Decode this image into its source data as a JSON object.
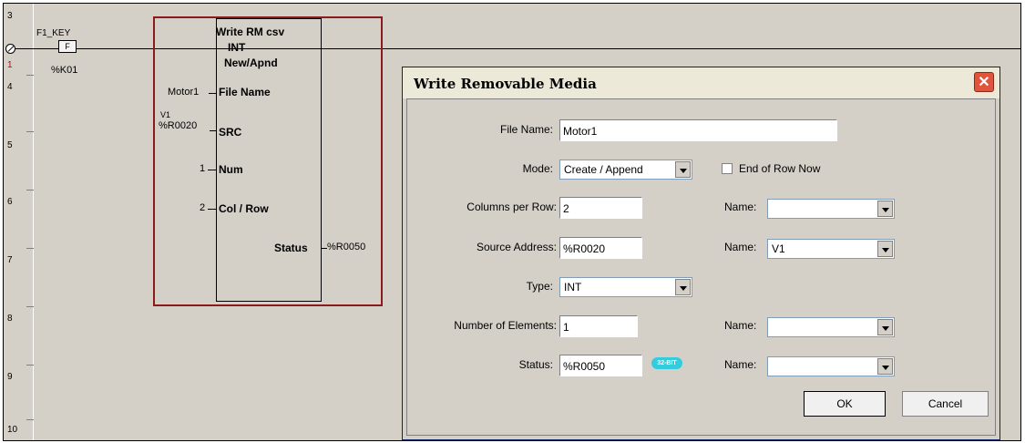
{
  "ladder": {
    "rungs": [
      {
        "label": "3"
      },
      {
        "label": "1"
      },
      {
        "label": "4"
      },
      {
        "label": "5"
      },
      {
        "label": "6"
      },
      {
        "label": "7"
      },
      {
        "label": "8"
      },
      {
        "label": "9"
      },
      {
        "label": "10"
      }
    ],
    "contact_name": "F1_KEY",
    "contact_symbol": "F",
    "contact_address": "%K01",
    "block": {
      "title": "Write RM csv",
      "type": "INT",
      "mode": "New/Apnd",
      "pins": {
        "file_name": {
          "label": "File Name",
          "value": "Motor1"
        },
        "src": {
          "label": "SRC",
          "nick": "V1",
          "value": "%R0020"
        },
        "num": {
          "label": "Num",
          "value": "1"
        },
        "col_row": {
          "label": "Col / Row",
          "value": "2"
        },
        "status": {
          "label": "Status",
          "value": "%R0050"
        }
      }
    }
  },
  "dialog": {
    "title": "Write Removable Media",
    "close_label": "✕",
    "file_name": {
      "label": "File Name:",
      "value": "Motor1"
    },
    "mode": {
      "label": "Mode:",
      "value": "Create / Append"
    },
    "end_of_row": {
      "label": "End of Row Now"
    },
    "columns_per_row": {
      "label": "Columns per Row:",
      "value": "2"
    },
    "source_address": {
      "label": "Source Address:",
      "value": "%R0020"
    },
    "type": {
      "label": "Type:",
      "value": "INT"
    },
    "number_of_elements": {
      "label": "Number of Elements:",
      "value": "1"
    },
    "status": {
      "label": "Status:",
      "value": "%R0050",
      "badge": "32-BIT"
    },
    "names": [
      {
        "label": "Name:",
        "value": ""
      },
      {
        "label": "Name:",
        "value": "V1"
      },
      {
        "label": "Name:",
        "value": ""
      },
      {
        "label": "Name:",
        "value": ""
      }
    ],
    "ok_label": "OK",
    "cancel_label": "Cancel"
  }
}
